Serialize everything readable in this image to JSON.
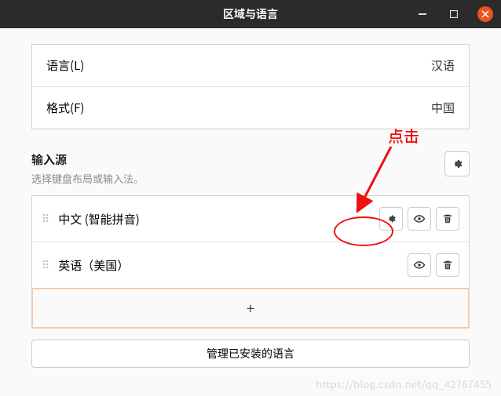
{
  "titlebar": {
    "title": "区域与语言"
  },
  "panel": {
    "language_label": "语言(L)",
    "language_value": "汉语",
    "format_label": "格式(F)",
    "format_value": "中国"
  },
  "input_section": {
    "title": "输入源",
    "subtitle": "选择键盘布局或输入法。"
  },
  "input_sources": [
    {
      "label": "中文 (智能拼音)",
      "has_settings": true
    },
    {
      "label": "英语（美国）",
      "has_settings": false
    }
  ],
  "add_label": "+",
  "manage_label": "管理已安装的语言",
  "annotation": {
    "label": "点击"
  },
  "watermark": "https://blog.csdn.net/qq_42767455"
}
